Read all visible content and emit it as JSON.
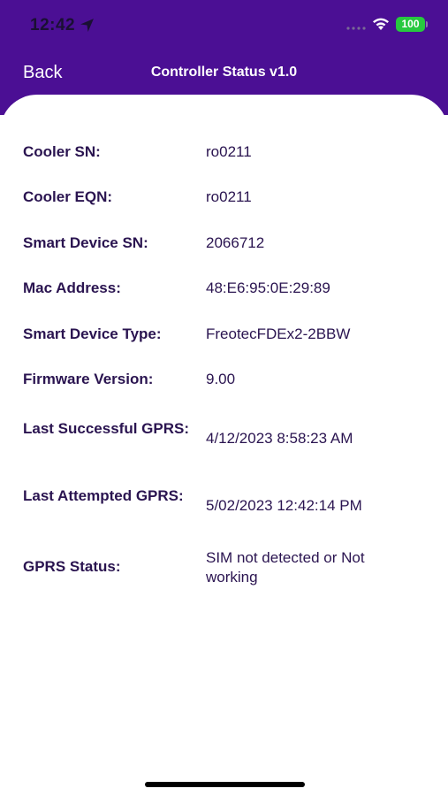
{
  "status_bar": {
    "time": "12:42",
    "battery": "100"
  },
  "nav": {
    "back_label": "Back",
    "title": "Controller Status v1.0"
  },
  "fields": [
    {
      "label": "Cooler SN:",
      "value": "ro0211"
    },
    {
      "label": "Cooler EQN:",
      "value": "ro0211"
    },
    {
      "label": "Smart Device SN:",
      "value": "2066712"
    },
    {
      "label": "Mac Address:",
      "value": "48:E6:95:0E:29:89"
    },
    {
      "label": "Smart Device Type:",
      "value": "FreotecFDEx2-2BBW"
    },
    {
      "label": "Firmware Version:",
      "value": "9.00"
    },
    {
      "label": "Last Successful GPRS:",
      "value": "4/12/2023 8:58:23 AM"
    },
    {
      "label": "Last Attempted GPRS:",
      "value": "5/02/2023 12:42:14 PM"
    },
    {
      "label": "GPRS Status:",
      "value": "SIM not detected or Not working"
    }
  ],
  "colors": {
    "header_purple": "#4b0f94",
    "label_text": "#2a1450",
    "battery_green": "#27c93f"
  },
  "icons": [
    "location-arrow-icon",
    "cellular-signal-icon",
    "wifi-icon",
    "battery-icon"
  ]
}
